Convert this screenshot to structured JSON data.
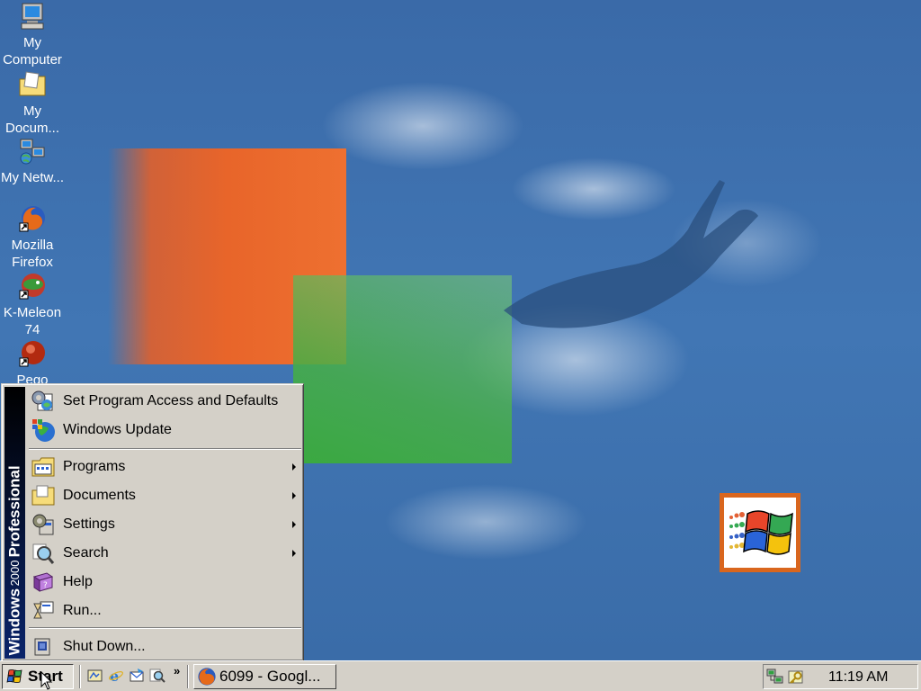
{
  "desktop": {
    "icons": [
      {
        "label": "My Computer",
        "icon": "computer-icon"
      },
      {
        "label": "My Docum...",
        "icon": "documents-folder-icon"
      },
      {
        "label": "My Netw...",
        "icon": "network-icon"
      },
      {
        "label": "Mozilla Firefox",
        "icon": "firefox-icon"
      },
      {
        "label": "K-Meleon 74",
        "icon": "k-meleon-icon"
      },
      {
        "label": "Pego",
        "icon": "app-shortcut-icon"
      }
    ]
  },
  "start_menu": {
    "banner": {
      "brand": "Windows",
      "version": "2000",
      "edition": "Professional"
    },
    "top_items": [
      {
        "label": "Set Program Access and Defaults",
        "icon": "program-access-icon"
      },
      {
        "label": "Windows Update",
        "icon": "windows-update-icon"
      }
    ],
    "main_items": [
      {
        "label": "Programs",
        "icon": "programs-icon",
        "submenu": true
      },
      {
        "label": "Documents",
        "icon": "documents-icon",
        "submenu": true
      },
      {
        "label": "Settings",
        "icon": "settings-icon",
        "submenu": true
      },
      {
        "label": "Search",
        "icon": "search-icon",
        "submenu": true
      },
      {
        "label": "Help",
        "icon": "help-icon",
        "submenu": false
      },
      {
        "label": "Run...",
        "icon": "run-icon",
        "submenu": false
      }
    ],
    "bottom_items": [
      {
        "label": "Shut Down...",
        "icon": "shutdown-icon"
      }
    ]
  },
  "taskbar": {
    "start_label": "Start",
    "quick_launch": [
      "show-desktop-icon",
      "internet-explorer-icon",
      "outlook-express-icon",
      "search-web-icon"
    ],
    "quick_launch_more": "»",
    "tasks": [
      {
        "label": "6099 - Googl...",
        "icon": "firefox-icon"
      }
    ],
    "tray": {
      "icons": [
        "network-tray-icon",
        "key-tray-icon"
      ],
      "clock": "11:19 AM"
    }
  },
  "colors": {
    "desktop_bg": "#3b6ea5",
    "menu_bg": "#d4d0c8",
    "banner_bg": "#0a246a",
    "logo_frame": "#d9661e"
  }
}
